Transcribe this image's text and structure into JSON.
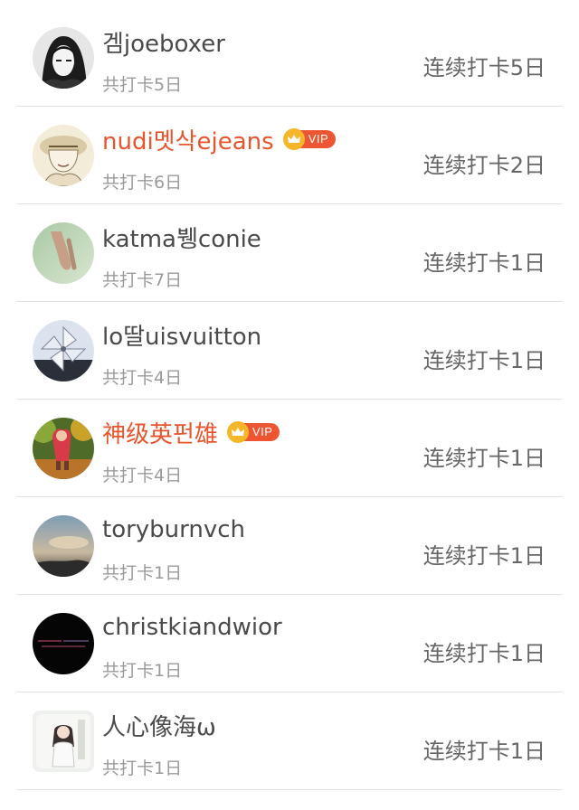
{
  "members": [
    {
      "name": "겜joeboxer",
      "vip": false,
      "total": "共打卡5日",
      "streak": "连续打卡5日",
      "avatar": "dark-anime-girl"
    },
    {
      "name": "nudi멧삭ejeans",
      "vip": true,
      "vip_label": "VIP",
      "total": "共打卡6日",
      "streak": "连续打卡2日",
      "avatar": "sketch-girl-hat"
    },
    {
      "name": "katma뷍conie",
      "vip": false,
      "total": "共打卡7日",
      "streak": "连续打卡1日",
      "avatar": "holding-hands"
    },
    {
      "name": "lo딸uisvuitton",
      "vip": false,
      "total": "共打卡4日",
      "streak": "连续打卡1日",
      "avatar": "pinwheel"
    },
    {
      "name": "神级英펀雄",
      "vip": true,
      "vip_label": "VIP",
      "total": "共打卡4日",
      "streak": "连续打卡1日",
      "avatar": "autumn-child"
    },
    {
      "name": "toryburnvch",
      "vip": false,
      "total": "共打卡1日",
      "streak": "连续打卡1日",
      "avatar": "sky-sunset"
    },
    {
      "name": "christkiandwior",
      "vip": false,
      "total": "共打卡1日",
      "streak": "连续打卡1日",
      "avatar": "black-text"
    },
    {
      "name": "人心像海ω",
      "vip": false,
      "total": "共打卡1日",
      "streak": "连续打卡1日",
      "avatar": "girl-photo"
    }
  ],
  "colors": {
    "name_default": "#4a4a4a",
    "name_vip": "#e8552d",
    "vip_tag": "#ee5532",
    "crown": "#f5b629",
    "secondary_text": "#9a9a9a",
    "streak_text": "#666666",
    "divider": "#e2e2e2"
  }
}
